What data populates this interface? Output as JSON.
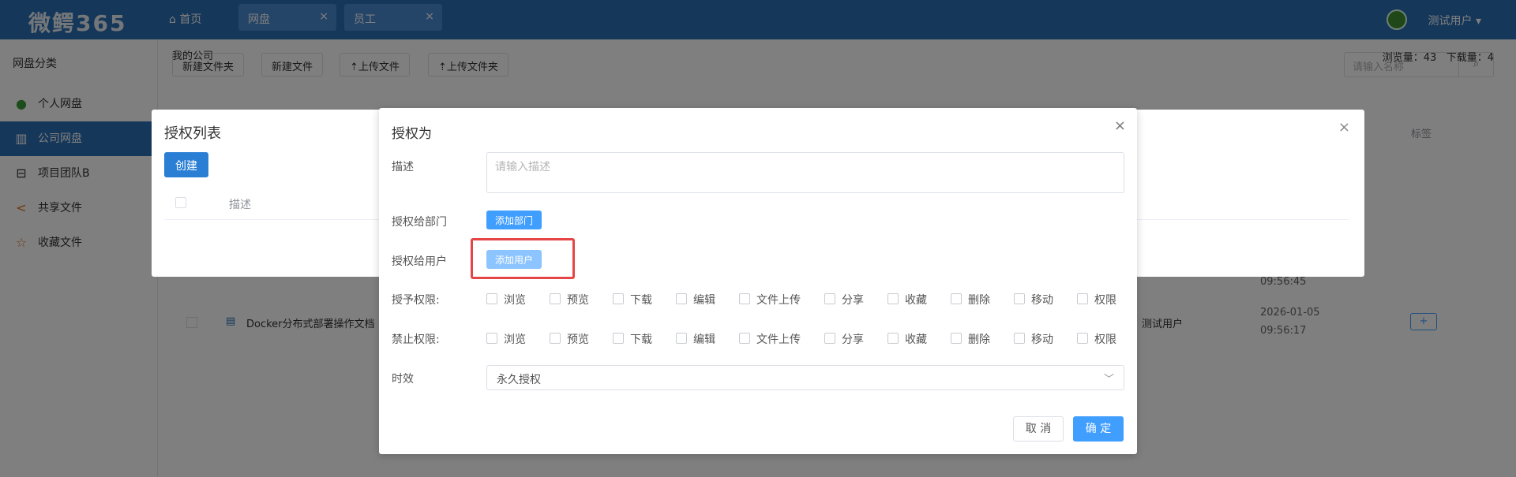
{
  "app": {
    "logo": "微鳄365",
    "home": "首页",
    "tabs": [
      {
        "label": "网盘"
      },
      {
        "label": "员工"
      }
    ],
    "user": "测试用户"
  },
  "sidebar": {
    "header": "网盘分类",
    "items": [
      {
        "label": "个人网盘",
        "icon": "user-icon"
      },
      {
        "label": "公司网盘",
        "icon": "building-icon"
      },
      {
        "label": "项目团队B",
        "icon": "inbox-icon"
      },
      {
        "label": "共享文件",
        "icon": "share-icon"
      },
      {
        "label": "收藏文件",
        "icon": "star-icon"
      }
    ]
  },
  "toolbar": {
    "new_folder": "新建文件夹",
    "new_file": "新建文件",
    "upload_file": "上传文件",
    "upload_folder": "上传文件夹",
    "search_placeholder": "请输入名称"
  },
  "breadcrumb": "我的公司",
  "stats": {
    "views_label": "浏览量：",
    "views": "43",
    "downloads_label": "下载量：",
    "downloads": "4"
  },
  "table": {
    "tag_header": "标签",
    "rows": [
      {
        "date": "",
        "time": "09:56:45"
      },
      {
        "name": "Docker分布式部署操作文档",
        "owner": "测试用户",
        "date": "2026-01-05",
        "time": "09:56:17"
      }
    ]
  },
  "auth_list": {
    "title": "授权列表",
    "create": "创建",
    "col_desc": "描述"
  },
  "dialog": {
    "title": "授权为",
    "desc_label": "描述",
    "desc_placeholder": "请输入描述",
    "dept_label": "授权给部门",
    "dept_button": "添加部门",
    "user_label": "授权给用户",
    "user_button": "添加用户",
    "grant_label": "授予权限:",
    "deny_label": "禁止权限:",
    "permissions": [
      "浏览",
      "预览",
      "下载",
      "编辑",
      "文件上传",
      "分享",
      "收藏",
      "删除",
      "移动",
      "权限"
    ],
    "expiry_label": "时效",
    "expiry_value": "永久授权",
    "cancel": "取 消",
    "ok": "确 定"
  }
}
